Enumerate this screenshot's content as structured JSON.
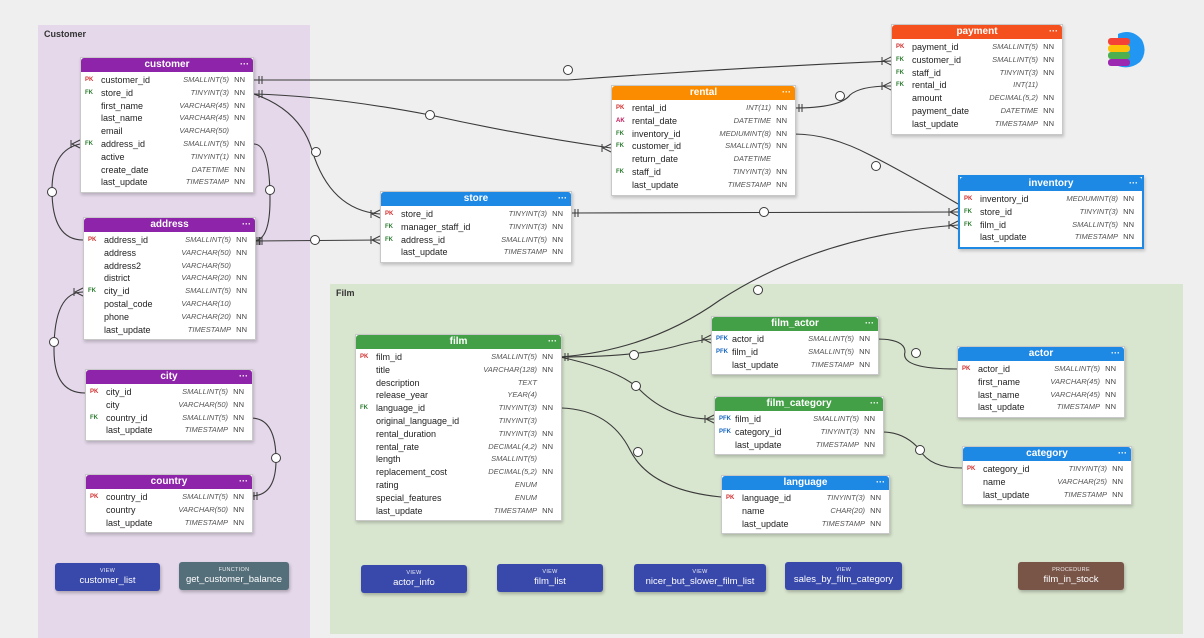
{
  "colors": {
    "purple": "#8e24aa",
    "blue": "#1e88e5",
    "orange": "#fb8c00",
    "red": "#f4511e",
    "green": "#43a047",
    "customer_group_bg": "#e4d8ea",
    "film_group_bg": "#d9e6cf",
    "view_bg": "#3949ab",
    "function_bg": "#546e7a",
    "procedure_bg": "#795548"
  },
  "groups": [
    {
      "label": "Customer"
    },
    {
      "label": "Film"
    }
  ],
  "menu_glyph": "···",
  "tables": [
    {
      "name": "customer",
      "color": "purple",
      "columns": [
        {
          "key": "PK",
          "name": "customer_id",
          "type": "SMALLINT(5)",
          "nn": "NN"
        },
        {
          "key": "FK",
          "name": "store_id",
          "type": "TINYINT(3)",
          "nn": "NN"
        },
        {
          "key": "",
          "name": "first_name",
          "type": "VARCHAR(45)",
          "nn": "NN"
        },
        {
          "key": "",
          "name": "last_name",
          "type": "VARCHAR(45)",
          "nn": "NN"
        },
        {
          "key": "",
          "name": "email",
          "type": "VARCHAR(50)",
          "nn": ""
        },
        {
          "key": "FK",
          "name": "address_id",
          "type": "SMALLINT(5)",
          "nn": "NN"
        },
        {
          "key": "",
          "name": "active",
          "type": "TINYINT(1)",
          "nn": "NN"
        },
        {
          "key": "",
          "name": "create_date",
          "type": "DATETIME",
          "nn": "NN"
        },
        {
          "key": "",
          "name": "last_update",
          "type": "TIMESTAMP",
          "nn": "NN"
        }
      ]
    },
    {
      "name": "address",
      "color": "purple",
      "columns": [
        {
          "key": "PK",
          "name": "address_id",
          "type": "SMALLINT(5)",
          "nn": "NN"
        },
        {
          "key": "",
          "name": "address",
          "type": "VARCHAR(50)",
          "nn": "NN"
        },
        {
          "key": "",
          "name": "address2",
          "type": "VARCHAR(50)",
          "nn": ""
        },
        {
          "key": "",
          "name": "district",
          "type": "VARCHAR(20)",
          "nn": "NN"
        },
        {
          "key": "FK",
          "name": "city_id",
          "type": "SMALLINT(5)",
          "nn": "NN"
        },
        {
          "key": "",
          "name": "postal_code",
          "type": "VARCHAR(10)",
          "nn": ""
        },
        {
          "key": "",
          "name": "phone",
          "type": "VARCHAR(20)",
          "nn": "NN"
        },
        {
          "key": "",
          "name": "last_update",
          "type": "TIMESTAMP",
          "nn": "NN"
        }
      ]
    },
    {
      "name": "city",
      "color": "purple",
      "columns": [
        {
          "key": "PK",
          "name": "city_id",
          "type": "SMALLINT(5)",
          "nn": "NN"
        },
        {
          "key": "",
          "name": "city",
          "type": "VARCHAR(50)",
          "nn": "NN"
        },
        {
          "key": "FK",
          "name": "country_id",
          "type": "SMALLINT(5)",
          "nn": "NN"
        },
        {
          "key": "",
          "name": "last_update",
          "type": "TIMESTAMP",
          "nn": "NN"
        }
      ]
    },
    {
      "name": "country",
      "color": "purple",
      "columns": [
        {
          "key": "PK",
          "name": "country_id",
          "type": "SMALLINT(5)",
          "nn": "NN"
        },
        {
          "key": "",
          "name": "country",
          "type": "VARCHAR(50)",
          "nn": "NN"
        },
        {
          "key": "",
          "name": "last_update",
          "type": "TIMESTAMP",
          "nn": "NN"
        }
      ]
    },
    {
      "name": "store",
      "color": "blue",
      "columns": [
        {
          "key": "PK",
          "name": "store_id",
          "type": "TINYINT(3)",
          "nn": "NN"
        },
        {
          "key": "FK",
          "name": "manager_staff_id",
          "type": "TINYINT(3)",
          "nn": "NN"
        },
        {
          "key": "FK",
          "name": "address_id",
          "type": "SMALLINT(5)",
          "nn": "NN"
        },
        {
          "key": "",
          "name": "last_update",
          "type": "TIMESTAMP",
          "nn": "NN"
        }
      ]
    },
    {
      "name": "rental",
      "color": "orange",
      "columns": [
        {
          "key": "PK",
          "name": "rental_id",
          "type": "INT(11)",
          "nn": "NN"
        },
        {
          "key": "AK",
          "name": "rental_date",
          "type": "DATETIME",
          "nn": "NN"
        },
        {
          "key": "FK",
          "name": "inventory_id",
          "type": "MEDIUMINT(8)",
          "nn": "NN"
        },
        {
          "key": "FK",
          "name": "customer_id",
          "type": "SMALLINT(5)",
          "nn": "NN"
        },
        {
          "key": "",
          "name": "return_date",
          "type": "DATETIME",
          "nn": ""
        },
        {
          "key": "FK",
          "name": "staff_id",
          "type": "TINYINT(3)",
          "nn": "NN"
        },
        {
          "key": "",
          "name": "last_update",
          "type": "TIMESTAMP",
          "nn": "NN"
        }
      ]
    },
    {
      "name": "payment",
      "color": "red",
      "columns": [
        {
          "key": "PK",
          "name": "payment_id",
          "type": "SMALLINT(5)",
          "nn": "NN"
        },
        {
          "key": "FK",
          "name": "customer_id",
          "type": "SMALLINT(5)",
          "nn": "NN"
        },
        {
          "key": "FK",
          "name": "staff_id",
          "type": "TINYINT(3)",
          "nn": "NN"
        },
        {
          "key": "FK",
          "name": "rental_id",
          "type": "INT(11)",
          "nn": ""
        },
        {
          "key": "",
          "name": "amount",
          "type": "DECIMAL(5,2)",
          "nn": "NN"
        },
        {
          "key": "",
          "name": "payment_date",
          "type": "DATETIME",
          "nn": "NN"
        },
        {
          "key": "",
          "name": "last_update",
          "type": "TIMESTAMP",
          "nn": "NN"
        }
      ]
    },
    {
      "name": "inventory",
      "color": "blue",
      "columns": [
        {
          "key": "PK",
          "name": "inventory_id",
          "type": "MEDIUMINT(8)",
          "nn": "NN"
        },
        {
          "key": "FK",
          "name": "store_id",
          "type": "TINYINT(3)",
          "nn": "NN"
        },
        {
          "key": "FK",
          "name": "film_id",
          "type": "SMALLINT(5)",
          "nn": "NN"
        },
        {
          "key": "",
          "name": "last_update",
          "type": "TIMESTAMP",
          "nn": "NN"
        }
      ]
    },
    {
      "name": "film",
      "color": "green",
      "columns": [
        {
          "key": "PK",
          "name": "film_id",
          "type": "SMALLINT(5)",
          "nn": "NN"
        },
        {
          "key": "",
          "name": "title",
          "type": "VARCHAR(128)",
          "nn": "NN"
        },
        {
          "key": "",
          "name": "description",
          "type": "TEXT",
          "nn": ""
        },
        {
          "key": "",
          "name": "release_year",
          "type": "YEAR(4)",
          "nn": ""
        },
        {
          "key": "FK",
          "name": "language_id",
          "type": "TINYINT(3)",
          "nn": "NN"
        },
        {
          "key": "",
          "name": "original_language_id",
          "type": "TINYINT(3)",
          "nn": ""
        },
        {
          "key": "",
          "name": "rental_duration",
          "type": "TINYINT(3)",
          "nn": "NN"
        },
        {
          "key": "",
          "name": "rental_rate",
          "type": "DECIMAL(4,2)",
          "nn": "NN"
        },
        {
          "key": "",
          "name": "length",
          "type": "SMALLINT(5)",
          "nn": ""
        },
        {
          "key": "",
          "name": "replacement_cost",
          "type": "DECIMAL(5,2)",
          "nn": "NN"
        },
        {
          "key": "",
          "name": "rating",
          "type": "ENUM",
          "nn": ""
        },
        {
          "key": "",
          "name": "special_features",
          "type": "ENUM",
          "nn": ""
        },
        {
          "key": "",
          "name": "last_update",
          "type": "TIMESTAMP",
          "nn": "NN"
        }
      ]
    },
    {
      "name": "film_actor",
      "color": "green",
      "columns": [
        {
          "key": "PFK",
          "name": "actor_id",
          "type": "SMALLINT(5)",
          "nn": "NN"
        },
        {
          "key": "PFK",
          "name": "film_id",
          "type": "SMALLINT(5)",
          "nn": "NN"
        },
        {
          "key": "",
          "name": "last_update",
          "type": "TIMESTAMP",
          "nn": "NN"
        }
      ]
    },
    {
      "name": "film_category",
      "color": "green",
      "columns": [
        {
          "key": "PFK",
          "name": "film_id",
          "type": "SMALLINT(5)",
          "nn": "NN"
        },
        {
          "key": "PFK",
          "name": "category_id",
          "type": "TINYINT(3)",
          "nn": "NN"
        },
        {
          "key": "",
          "name": "last_update",
          "type": "TIMESTAMP",
          "nn": "NN"
        }
      ]
    },
    {
      "name": "language",
      "color": "blue",
      "columns": [
        {
          "key": "PK",
          "name": "language_id",
          "type": "TINYINT(3)",
          "nn": "NN"
        },
        {
          "key": "",
          "name": "name",
          "type": "CHAR(20)",
          "nn": "NN"
        },
        {
          "key": "",
          "name": "last_update",
          "type": "TIMESTAMP",
          "nn": "NN"
        }
      ]
    },
    {
      "name": "actor",
      "color": "blue",
      "columns": [
        {
          "key": "PK",
          "name": "actor_id",
          "type": "SMALLINT(5)",
          "nn": "NN"
        },
        {
          "key": "",
          "name": "first_name",
          "type": "VARCHAR(45)",
          "nn": "NN"
        },
        {
          "key": "",
          "name": "last_name",
          "type": "VARCHAR(45)",
          "nn": "NN"
        },
        {
          "key": "",
          "name": "last_update",
          "type": "TIMESTAMP",
          "nn": "NN"
        }
      ]
    },
    {
      "name": "category",
      "color": "blue",
      "columns": [
        {
          "key": "PK",
          "name": "category_id",
          "type": "TINYINT(3)",
          "nn": "NN"
        },
        {
          "key": "",
          "name": "name",
          "type": "VARCHAR(25)",
          "nn": "NN"
        },
        {
          "key": "",
          "name": "last_update",
          "type": "TIMESTAMP",
          "nn": "NN"
        }
      ]
    }
  ],
  "objects": [
    {
      "kind": "VIEW",
      "name": "customer_list",
      "color": "view_bg"
    },
    {
      "kind": "FUNCTION",
      "name": "get_customer_balance",
      "color": "function_bg"
    },
    {
      "kind": "VIEW",
      "name": "actor_info",
      "color": "view_bg"
    },
    {
      "kind": "VIEW",
      "name": "film_list",
      "color": "view_bg"
    },
    {
      "kind": "VIEW",
      "name": "nicer_but_slower_film_list",
      "color": "view_bg"
    },
    {
      "kind": "VIEW",
      "name": "sales_by_film_category",
      "color": "view_bg"
    },
    {
      "kind": "PROCEDURE",
      "name": "film_in_stock",
      "color": "procedure_bg"
    }
  ]
}
